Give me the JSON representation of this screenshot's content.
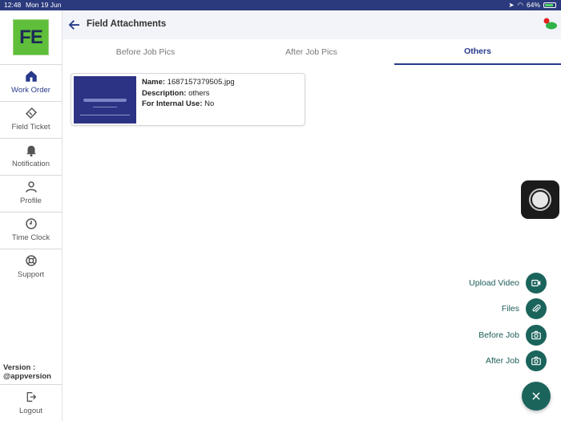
{
  "status_bar": {
    "time": "12:48",
    "date": "Mon 19 Jun",
    "battery": "64%"
  },
  "sidebar": {
    "logo": "FE",
    "items": [
      {
        "label": "Work Order",
        "icon": "home-icon",
        "active": true
      },
      {
        "label": "Field Ticket",
        "icon": "ticket-icon",
        "active": false
      },
      {
        "label": "Notification",
        "icon": "bell-icon",
        "active": false
      },
      {
        "label": "Profile",
        "icon": "person-icon",
        "active": false
      },
      {
        "label": "Time Clock",
        "icon": "clock-icon",
        "active": false
      },
      {
        "label": "Support",
        "icon": "lifebuoy-icon",
        "active": false
      }
    ],
    "version_label": "Version :",
    "version_value": "@appversion",
    "logout_label": "Logout"
  },
  "header": {
    "title": "Field Attachments"
  },
  "tabs": [
    {
      "label": "Before Job Pics",
      "active": false
    },
    {
      "label": "After Job Pics",
      "active": false
    },
    {
      "label": "Others",
      "active": true
    }
  ],
  "attachments": [
    {
      "name_label": "Name:",
      "name": "1687157379505.jpg",
      "description_label": "Description:",
      "description": "others",
      "internal_label": "For Internal Use:",
      "internal": "No"
    }
  ],
  "actions": [
    {
      "label": "Upload Video",
      "icon": "video-icon"
    },
    {
      "label": "Files",
      "icon": "paperclip-icon"
    },
    {
      "label": "Before Job",
      "icon": "camera-icon"
    },
    {
      "label": "After Job",
      "icon": "camera-icon"
    }
  ],
  "colors": {
    "primary": "#27398b",
    "accent": "#1b645c",
    "status_bar": "#2b3a7c",
    "logo": "#5fbf3a"
  }
}
